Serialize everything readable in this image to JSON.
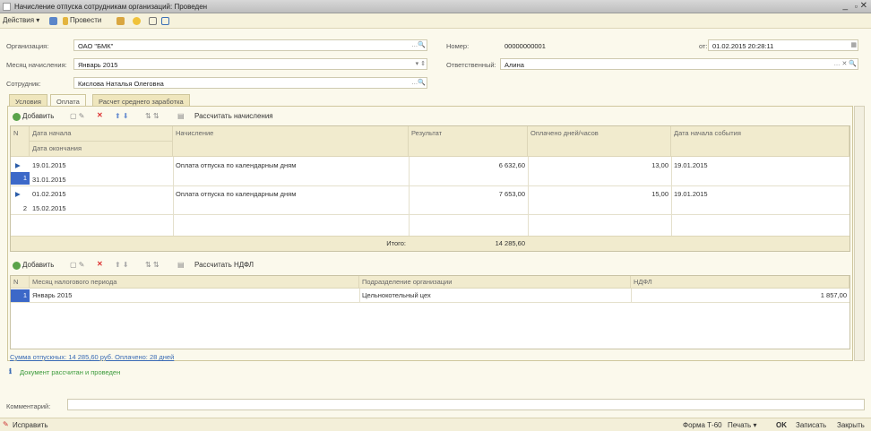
{
  "window": {
    "title": "Начисление отпуска сотрудникам организаций: Проведен"
  },
  "toolbar": {
    "actions": "Действия",
    "post": "Провести"
  },
  "form": {
    "organization_label": "Организация:",
    "organization": "ОАО \"БМК\"",
    "month_label": "Месяц начисления:",
    "month": "Январь 2015",
    "employee_label": "Сотрудник:",
    "employee": "Кислова Наталья Олеговна",
    "number_label": "Номер:",
    "number": "00000000001",
    "date_label": "от:",
    "date": "01.02.2015 20:28:11",
    "responsible_label": "Ответственный:",
    "responsible": "Алина"
  },
  "tabs": [
    "Условия",
    "Оплата",
    "Расчет среднего заработка"
  ],
  "accruals": {
    "add": "Добавить",
    "calc": "Рассчитать начисления",
    "headers": {
      "n": "N",
      "start": "Дата начала",
      "end": "Дата окончания",
      "type": "Начисление",
      "result": "Результат",
      "paid": "Оплачено дней/часов",
      "event": "Дата начала события"
    },
    "rows": [
      {
        "n": "1",
        "start": "19.01.2015",
        "end": "31.01.2015",
        "type": "Оплата отпуска по календарным дням",
        "result": "6 632,60",
        "paid": "13,00",
        "event": "19.01.2015"
      },
      {
        "n": "2",
        "start": "01.02.2015",
        "end": "15.02.2015",
        "type": "Оплата отпуска по календарным дням",
        "result": "7 653,00",
        "paid": "15,00",
        "event": "19.01.2015"
      }
    ],
    "total_label": "Итого:",
    "total": "14 285,60"
  },
  "ndfl": {
    "add": "Добавить",
    "calc": "Рассчитать НДФЛ",
    "headers": {
      "n": "N",
      "month": "Месяц налогового периода",
      "dept": "Подразделение организации",
      "ndfl": "НДФЛ"
    },
    "rows": [
      {
        "n": "1",
        "month": "Январь 2015",
        "dept": "Цельнокотельный цех",
        "ndfl": "1 857,00"
      }
    ]
  },
  "summary": "Сумма отпускных: 14 285,60 руб. Оплачено: 28 дней",
  "info": "Документ рассчитан и проведен",
  "comment_label": "Комментарий:",
  "comment": "",
  "bottom": {
    "fix": "Исправить",
    "form": "Форма Т-60",
    "print": "Печать",
    "ok": "OK",
    "save": "Записать",
    "close": "Закрыть"
  }
}
